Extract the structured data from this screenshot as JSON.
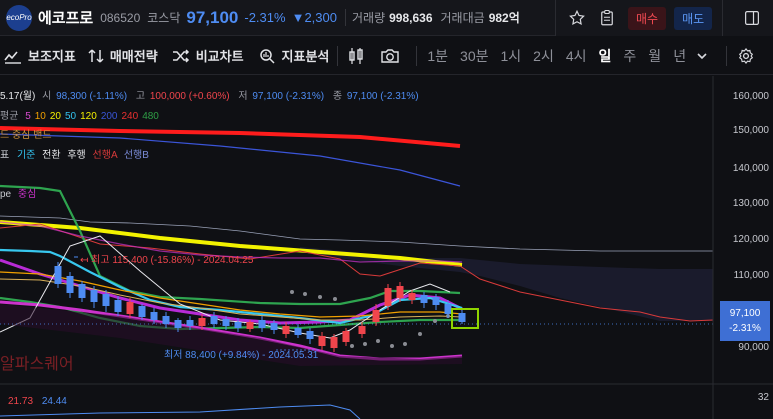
{
  "header": {
    "logo_text": "ecoPro",
    "name": "에코프로",
    "code": "086520",
    "market": "코스닥",
    "price": "97,100",
    "change_pct": "-2.31%",
    "change_amt": "2,300",
    "volume_label": "거래량",
    "volume": "998,636",
    "value_label": "거래대금",
    "value": "982억",
    "buy_label": "매수",
    "sell_label": "매도"
  },
  "toolbar": {
    "indicators": "보조지표",
    "strategy": "매매전략",
    "compare": "비교차트",
    "analysis": "지표분석",
    "timeframes": [
      "1분",
      "30분",
      "1시",
      "2시",
      "4시",
      "일",
      "주",
      "월",
      "년"
    ],
    "active_timeframe": "일"
  },
  "legend": {
    "ohlc_date": "5.17(월)",
    "open_label": "시",
    "open": "98,300 (-1.11%)",
    "high_label": "고",
    "high": "100,000 (+0.60%)",
    "low_label": "저",
    "low": "97,100 (-2.31%)",
    "close_label": "종",
    "close": "97,100 (-2.31%)",
    "ma_label": "평균",
    "ma_periods": [
      "5",
      "10",
      "20",
      "50",
      "120",
      "200",
      "240",
      "480"
    ],
    "bb_label": "드 중심 밴드",
    "ichimoku_label": "표",
    "ichimoku_items": [
      "기준",
      "전환",
      "후행",
      "선행A",
      "선행B"
    ],
    "env_label": "pe",
    "env_item": "중심",
    "watermark": "알파스퀘어",
    "sub_values": [
      "21.73",
      "24.44"
    ]
  },
  "annotations": {
    "high_note": "최고 115,400 (-15.86%) - 2024.04.25",
    "low_note": "최저 88,400 (+9.84%) - 2024.05.31"
  },
  "axis": {
    "price_ticks": [
      "160,000",
      "150,000",
      "140,000",
      "130,000",
      "120,000",
      "110,000",
      "90,000"
    ],
    "current_price": "97,100",
    "current_change": "-2.31%",
    "sub_tick": "32"
  },
  "colors": {
    "up": "#f0454c",
    "down": "#4e8cf2",
    "ma5": "#d94bd0",
    "ma10": "#f0a000",
    "ma20": "#fffb00",
    "ma50": "#33c3f0",
    "ma120": "#f5f000",
    "ma200": "#3955d6",
    "ma240": "#e83030",
    "ma480": "#2e9e45"
  }
}
